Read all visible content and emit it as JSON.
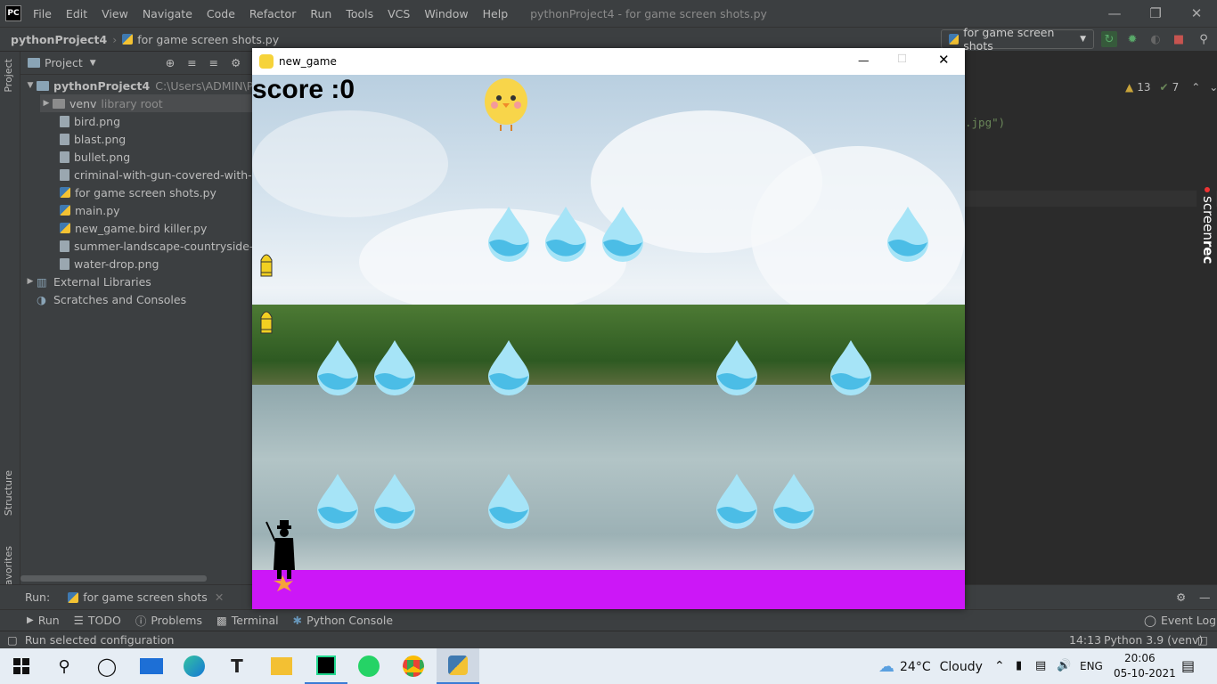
{
  "titlebar": {
    "app_logo": "PC",
    "menus": [
      "File",
      "Edit",
      "View",
      "Navigate",
      "Code",
      "Refactor",
      "Run",
      "Tools",
      "VCS",
      "Window",
      "Help"
    ],
    "title": "pythonProject4 - for game screen shots.py"
  },
  "navbar": {
    "project": "pythonProject4",
    "file": "for game screen shots.py",
    "run_config": "for game screen shots"
  },
  "project_panel": {
    "header": "Project",
    "root_name": "pythonProject4",
    "root_path": "C:\\Users\\ADMIN\\Pycha",
    "venv": "venv",
    "venv_note": "library root",
    "files": [
      "bird.png",
      "blast.png",
      "bullet.png",
      "criminal-with-gun-covered-with-coat",
      "for game screen shots.py",
      "main.py",
      "new_game.bird killer.py",
      "summer-landscape-countryside-with-",
      "water-drop.png"
    ],
    "external": "External Libraries",
    "scratches": "Scratches and Consoles"
  },
  "side_tabs": {
    "project": "Project",
    "structure": "Structure",
    "favorites": "Favorites"
  },
  "editor": {
    "warnings": "13",
    "weak_warnings": "7",
    "code_fragment": ".jpg\")"
  },
  "screenrec": {
    "prefix": "screen",
    "suffix": "rec"
  },
  "game": {
    "title": "new_game",
    "score_text": "score :0",
    "floor_color": "#cc17f7"
  },
  "run_bar": {
    "label": "Run:",
    "tab": "for game screen shots"
  },
  "bottom_tabs": [
    "Run",
    "TODO",
    "Problems",
    "Terminal",
    "Python Console"
  ],
  "event_log": "Event Log",
  "status": {
    "message": "Run selected configuration",
    "position": "14:13",
    "interpreter": "Python 3.9 (venv)"
  },
  "taskbar": {
    "weather_temp": "24°C",
    "weather_text": "Cloudy",
    "lang": "ENG",
    "time": "20:06",
    "date": "05-10-2021"
  }
}
